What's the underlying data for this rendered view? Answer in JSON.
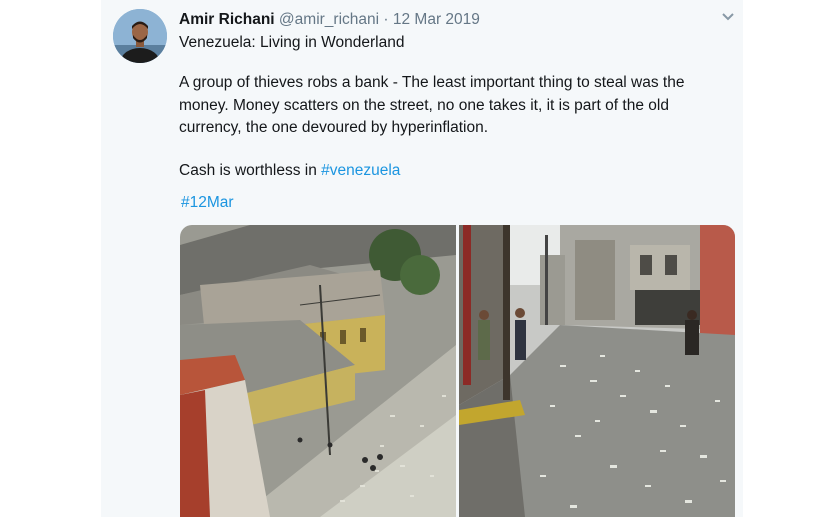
{
  "tweet": {
    "author_name": "Amir Richani",
    "handle": "@amir_richani",
    "separator": "·",
    "date": "12 Mar 2019",
    "subtitle": "Venezuela: Living in Wonderland",
    "paragraph1": "A group of thieves robs a bank - The least important thing to steal was the money. Money scatters on the street, no one takes it, it is part of the old currency, the one devoured by hyperinflation.",
    "paragraph2_prefix": "Cash is worthless in ",
    "paragraph2_hashtag": "#venezuela",
    "hashtag_line": "#12Mar"
  },
  "icons": {
    "menu": "chevron-down-icon"
  },
  "colors": {
    "link": "#1b95e0",
    "muted": "#657786",
    "card_bg": "#f5f8fa"
  }
}
